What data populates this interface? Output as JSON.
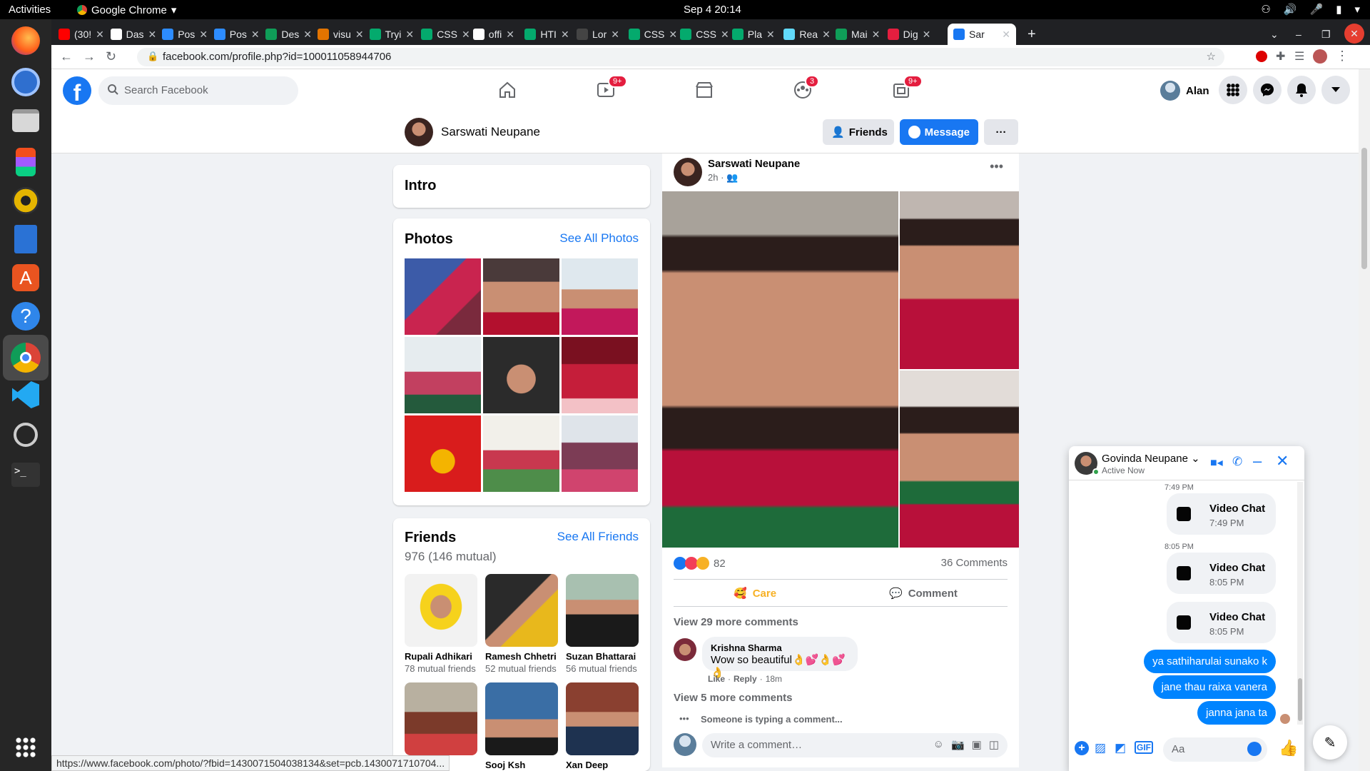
{
  "system": {
    "activities": "Activities",
    "app_name": "Google Chrome",
    "clock": "Sep 4  20:14"
  },
  "tabs": [
    {
      "label": "(30!",
      "color": "#ff0000"
    },
    {
      "label": "Das",
      "color": "#ffffff"
    },
    {
      "label": "Pos",
      "color": "#2d8cff"
    },
    {
      "label": "Pos",
      "color": "#2d8cff"
    },
    {
      "label": "Des",
      "color": "#0f9d58"
    },
    {
      "label": "visu",
      "color": "#e37400"
    },
    {
      "label": "Tryi",
      "color": "#04aa6d"
    },
    {
      "label": "CSS",
      "color": "#04aa6d"
    },
    {
      "label": "offi",
      "color": "#ffffff"
    },
    {
      "label": "HTI",
      "color": "#04aa6d"
    },
    {
      "label": "Lor",
      "color": "#444444"
    },
    {
      "label": "CSS",
      "color": "#04aa6d"
    },
    {
      "label": "CSS",
      "color": "#04aa6d"
    },
    {
      "label": "Pla",
      "color": "#04aa6d"
    },
    {
      "label": "Rea",
      "color": "#61dafb"
    },
    {
      "label": "Mai",
      "color": "#0f9d58"
    },
    {
      "label": "Dig",
      "color": "#e41e3f"
    },
    {
      "label": "Sar",
      "color": "#1877f2"
    }
  ],
  "address_bar": {
    "url": "facebook.com/profile.php?id=100011058944706"
  },
  "fb": {
    "search_placeholder": "Search Facebook",
    "nav_badges": {
      "watch": "9+",
      "groups": "3",
      "gaming": "9+"
    },
    "user": "Alan"
  },
  "profile": {
    "name": "Sarswati Neupane",
    "friends_btn": "Friends",
    "message_btn": "Message",
    "more_btn": "···"
  },
  "intro": {
    "title": "Intro"
  },
  "photos": {
    "title": "Photos",
    "see_all": "See All Photos"
  },
  "friends": {
    "title": "Friends",
    "see_all": "See All Friends",
    "count": "976 (146 mutual)",
    "list": [
      {
        "name": "Rupali Adhikari",
        "mutual": "78 mutual friends"
      },
      {
        "name": "Ramesh Chhetri",
        "mutual": "52 mutual friends"
      },
      {
        "name": "Suzan Bhattarai",
        "mutual": "56 mutual friends"
      },
      {
        "name": "",
        "mutual": ""
      },
      {
        "name": "Sooj Ksh",
        "mutual": ""
      },
      {
        "name": "Xan Deep",
        "mutual": ""
      }
    ]
  },
  "post": {
    "author": "Sarswati Neupane",
    "time": "2h",
    "reactions_count": "82",
    "comments_count": "36 Comments",
    "care_label": "Care",
    "comment_label": "Comment",
    "view_more_1": "View 29 more comments",
    "commenter": "Krishna Sharma",
    "comment_text": "Wow so beautiful👌💕👌💕👌",
    "comment_like": "Like",
    "comment_reply": "Reply",
    "comment_time": "18m",
    "view_more_2": "View 5 more comments",
    "typing": "Someone is typing a comment...",
    "write_placeholder": "Write a comment…"
  },
  "chat": {
    "name": "Govinda Neupane",
    "status": "Active Now",
    "ts1": "7:49 PM",
    "vc1_title": "Video Chat",
    "vc1_time": "7:49 PM",
    "ts2": "8:05 PM",
    "vc2_title": "Video Chat",
    "vc2_time": "8:05 PM",
    "vc3_title": "Video Chat",
    "vc3_time": "8:05 PM",
    "msg1": "ya sathiharulai sunako k",
    "msg2": "jane thau raixa vanera",
    "msg3": "janna jana ta",
    "input_placeholder": "Aa"
  },
  "status_url": "https://www.facebook.com/photo/?fbid=1430071504038134&set=pcb.1430071710704..."
}
